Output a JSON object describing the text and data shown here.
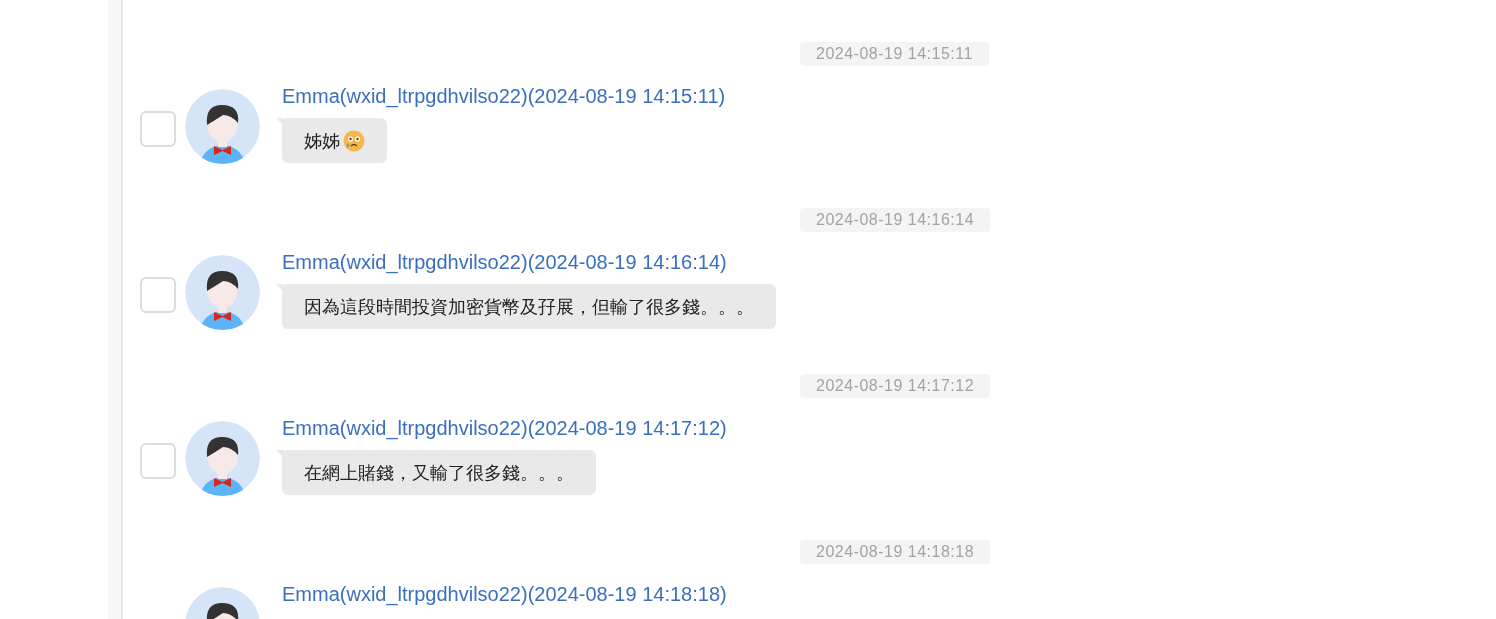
{
  "messages": [
    {
      "timestamp": "2024-08-19 14:15:11",
      "checked": false,
      "sender": "Emma(wxid_ltrpgdhvilso22)(2024-08-19 14:15:11)",
      "text": "姊姊",
      "emoji": true
    },
    {
      "timestamp": "2024-08-19 14:16:14",
      "checked": false,
      "sender": "Emma(wxid_ltrpgdhvilso22)(2024-08-19 14:16:14)",
      "text": "因為這段時間投資加密貨幣及孖展，但輸了很多錢。。。"
    },
    {
      "timestamp": "2024-08-19 14:17:12",
      "checked": false,
      "sender": "Emma(wxid_ltrpgdhvilso22)(2024-08-19 14:17:12)",
      "text": "在網上賭錢，又輸了很多錢。。。"
    },
    {
      "timestamp": "2024-08-19 14:18:18",
      "sender": "Emma(wxid_ltrpgdhvilso22)(2024-08-19 14:18:18)"
    }
  ]
}
